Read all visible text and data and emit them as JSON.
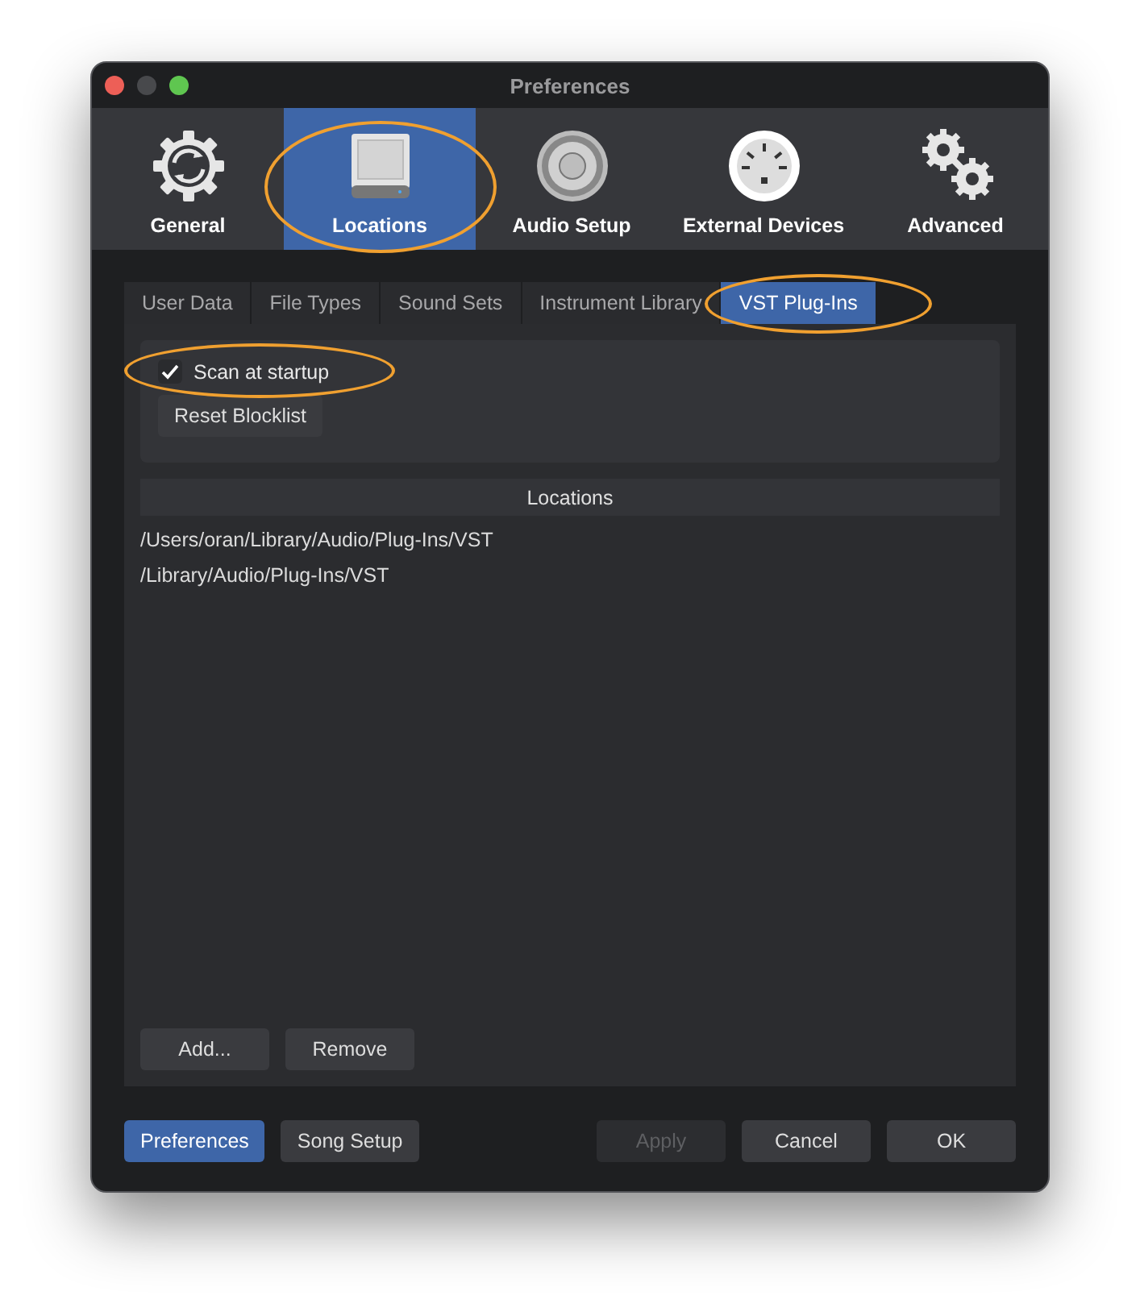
{
  "window": {
    "title": "Preferences"
  },
  "toolbar": [
    {
      "label": "General",
      "selected": false,
      "highlighted": false
    },
    {
      "label": "Locations",
      "selected": true,
      "highlighted": true
    },
    {
      "label": "Audio Setup",
      "selected": false,
      "highlighted": false
    },
    {
      "label": "External Devices",
      "selected": false,
      "highlighted": false
    },
    {
      "label": "Advanced",
      "selected": false,
      "highlighted": false
    }
  ],
  "tabs": [
    {
      "label": "User Data",
      "selected": false,
      "highlighted": false
    },
    {
      "label": "File Types",
      "selected": false,
      "highlighted": false
    },
    {
      "label": "Sound Sets",
      "selected": false,
      "highlighted": false
    },
    {
      "label": "Instrument Library",
      "selected": false,
      "highlighted": false
    },
    {
      "label": "VST Plug-Ins",
      "selected": true,
      "highlighted": true
    }
  ],
  "scan_option": {
    "label": "Scan at startup",
    "checked": true,
    "highlighted": true
  },
  "reset_button": "Reset Blocklist",
  "locations": {
    "header": "Locations",
    "rows": [
      "/Users/oran/Library/Audio/Plug-Ins/VST",
      "/Library/Audio/Plug-Ins/VST"
    ]
  },
  "list_buttons": [
    "Add...",
    "Remove"
  ],
  "footer_modes": [
    {
      "label": "Preferences",
      "selected": true
    },
    {
      "label": "Song Setup",
      "selected": false
    }
  ],
  "footer_buttons": [
    {
      "label": "Apply",
      "disabled": true
    },
    {
      "label": "Cancel",
      "disabled": false
    },
    {
      "label": "OK",
      "disabled": false
    }
  ]
}
